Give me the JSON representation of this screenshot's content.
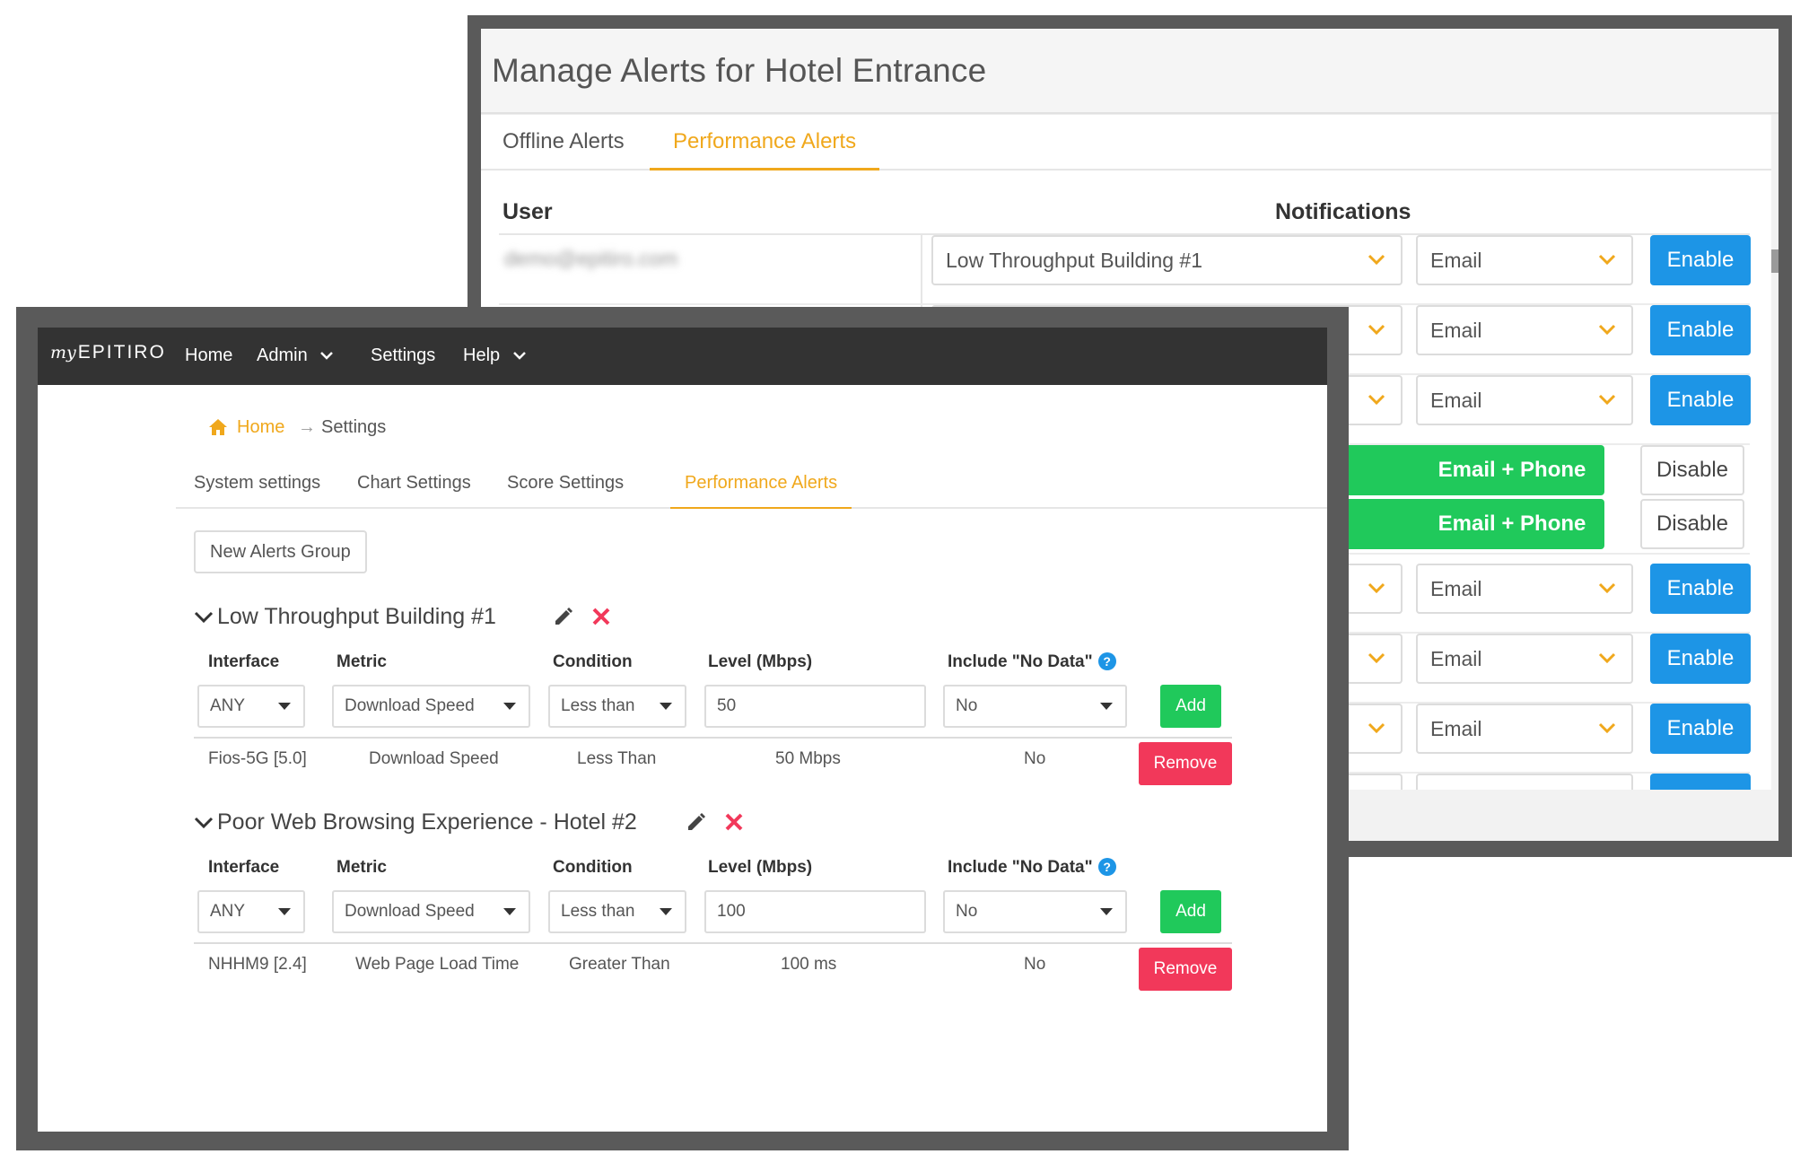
{
  "back_window": {
    "title": "Manage Alerts for Hotel Entrance",
    "tabs": [
      {
        "label": "Offline Alerts",
        "active": false
      },
      {
        "label": "Performance Alerts",
        "active": true
      }
    ],
    "columns": {
      "user": "User",
      "notifications": "Notifications"
    },
    "user_email_blurred": "demo@epitiro.com",
    "rows": [
      {
        "group": "Low Throughput Building #1",
        "channel": "Email",
        "action": "Enable"
      },
      {
        "group": "",
        "channel": "Email",
        "action": "Enable"
      },
      {
        "group": "",
        "channel": "Email",
        "action": "Enable"
      },
      {
        "group": "",
        "channel": "Email + Phone",
        "action": "Disable"
      },
      {
        "group": "",
        "channel": "Email + Phone",
        "action": "Disable"
      },
      {
        "group": "",
        "channel": "Email",
        "action": "Enable"
      },
      {
        "group": "",
        "channel": "Email",
        "action": "Enable"
      },
      {
        "group": "",
        "channel": "Email",
        "action": "Enable"
      }
    ]
  },
  "front_window": {
    "navbar": {
      "brand_prefix": "my",
      "brand": "EPITIRO",
      "items": [
        "Home",
        "Admin",
        "Settings",
        "Help"
      ]
    },
    "breadcrumb": {
      "home": "Home",
      "separator": "→",
      "current": "Settings"
    },
    "tabs": [
      {
        "label": "System settings",
        "active": false
      },
      {
        "label": "Chart Settings",
        "active": false
      },
      {
        "label": "Score Settings",
        "active": false
      },
      {
        "label": "Performance Alerts",
        "active": true
      }
    ],
    "new_group_button": "New Alerts Group",
    "form_labels": {
      "interface": "Interface",
      "metric": "Metric",
      "condition": "Condition",
      "level": "Level (Mbps)",
      "include_no_data": "Include \"No Data\"",
      "help": "?"
    },
    "buttons": {
      "add": "Add",
      "remove": "Remove"
    },
    "groups": [
      {
        "title": "Low Throughput Building #1",
        "form": {
          "interface": "ANY",
          "metric": "Download Speed",
          "condition": "Less than",
          "level": "50",
          "include_no_data": "No"
        },
        "rule": {
          "interface": "Fios-5G [5.0]",
          "metric": "Download Speed",
          "condition": "Less Than",
          "level": "50 Mbps",
          "include_no_data": "No"
        }
      },
      {
        "title": "Poor Web Browsing Experience - Hotel #2",
        "form": {
          "interface": "ANY",
          "metric": "Download Speed",
          "condition": "Less than",
          "level": "100",
          "include_no_data": "No"
        },
        "rule": {
          "interface": "NHHM9 [2.4]",
          "metric": "Web Page Load Time",
          "condition": "Greater Than",
          "level": "100 ms",
          "include_no_data": "No"
        }
      }
    ]
  },
  "colors": {
    "accent_orange": "#f0a81c",
    "enable_blue": "#1d95e6",
    "green": "#20c95b",
    "remove_red": "#f2385a",
    "navbar": "#333333"
  },
  "icons": [
    "chevron-down-icon",
    "home-icon",
    "pencil-icon",
    "close-icon",
    "help-icon",
    "caret-down-icon"
  ]
}
